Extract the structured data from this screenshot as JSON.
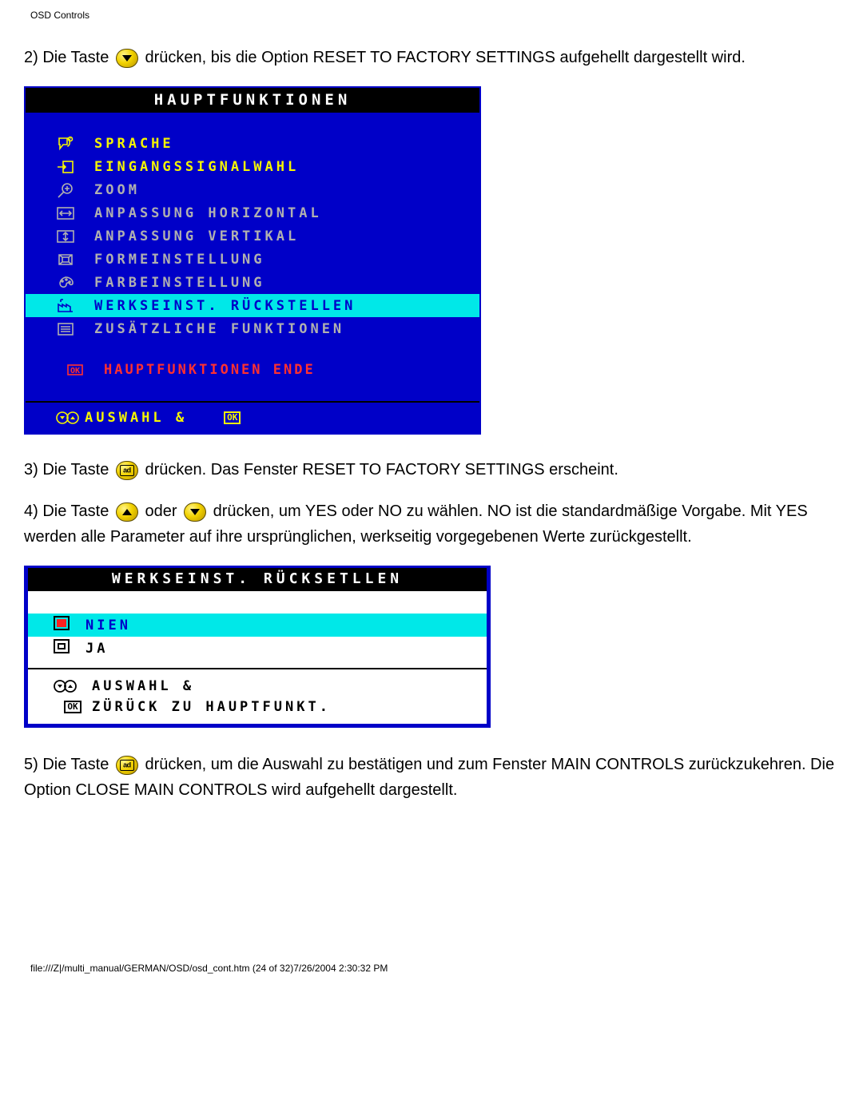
{
  "header": "OSD Controls",
  "step2_a": "2) Die Taste ",
  "step2_b": " drücken, bis die Option RESET TO FACTORY SETTINGS aufgehellt dargestellt wird.",
  "osd1": {
    "title": "HAUPTFUNKTIONEN",
    "items": [
      {
        "label": "SPRACHE",
        "cls": "yellow",
        "icon": "speech"
      },
      {
        "label": "EINGANGSSIGNALWAHL",
        "cls": "yellow",
        "icon": "input"
      },
      {
        "label": "ZOOM",
        "cls": "",
        "icon": "zoom"
      },
      {
        "label": "ANPASSUNG HORIZONTAL",
        "cls": "",
        "icon": "horiz"
      },
      {
        "label": "ANPASSUNG VERTIKAL",
        "cls": "",
        "icon": "vert"
      },
      {
        "label": "FORMEINSTELLUNG",
        "cls": "",
        "icon": "shape"
      },
      {
        "label": "FARBEINSTELLUNG",
        "cls": "",
        "icon": "palette"
      },
      {
        "label": "WERKSEINST. RÜCKSTELLEN",
        "cls": "hl",
        "icon": "factory"
      },
      {
        "label": "ZUSÄTZLICHE FUNKTIONEN",
        "cls": "",
        "icon": "list"
      }
    ],
    "close": "HAUPTFUNKTIONEN ENDE",
    "footer_select": "AUSWAHL &",
    "footer_ok": "OK"
  },
  "step3_a": "3) Die Taste ",
  "step3_b": " drücken. Das Fenster RESET TO FACTORY SETTINGS erscheint.",
  "step4_a": "4) Die Taste ",
  "step4_mid": " oder ",
  "step4_b": " drücken, um YES oder NO zu wählen. NO ist die standardmäßige Vorgabe. Mit YES werden alle Parameter auf ihre ursprünglichen, werkseitig vorgegebenen Werte zurückgestellt.",
  "osd2": {
    "title": "WERKSEINST. RÜCKSETLLEN",
    "opt_no": "NIEN",
    "opt_yes": "JA",
    "foot1": "AUSWAHL &",
    "foot2": "ZÜRÜCK ZU HAUPTFUNKT.",
    "ok": "OK"
  },
  "step5_a": "5) Die Taste ",
  "step5_b": " drücken, um die Auswahl zu bestätigen und zum Fenster MAIN CONTROLS zurückzukehren. Die Option CLOSE MAIN CONTROLS wird aufgehellt dargestellt.",
  "footer": "file:///Z|/multi_manual/GERMAN/OSD/osd_cont.htm (24 of 32)7/26/2004 2:30:32 PM"
}
